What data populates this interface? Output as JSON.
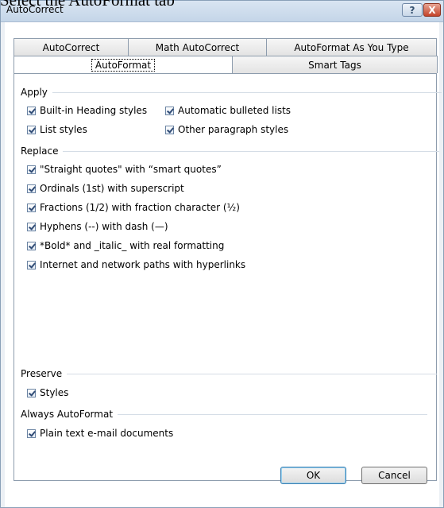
{
  "caption": "Select the AutoFormat tab",
  "window": {
    "title": "AutoCorrect",
    "help_label": "?",
    "close_label": "X"
  },
  "tabs": {
    "back_row": [
      "AutoCorrect",
      "Math AutoCorrect",
      "AutoFormat As You Type"
    ],
    "front_row": [
      "AutoFormat",
      "Smart Tags"
    ],
    "active": "AutoFormat"
  },
  "groups": {
    "apply": {
      "label": "Apply",
      "options": [
        {
          "label": "Built-in Heading styles",
          "checked": true
        },
        {
          "label": "Automatic bulleted lists",
          "checked": true
        },
        {
          "label": "List styles",
          "checked": true
        },
        {
          "label": "Other paragraph styles",
          "checked": true
        }
      ]
    },
    "replace": {
      "label": "Replace",
      "options": [
        {
          "label": "\"Straight quotes\" with “smart quotes”",
          "checked": true
        },
        {
          "label": "Ordinals (1st) with superscript",
          "checked": true
        },
        {
          "label": "Fractions (1/2) with fraction character (½)",
          "checked": true
        },
        {
          "label": "Hyphens (--) with dash (—)",
          "checked": true
        },
        {
          "label": "*Bold* and _italic_ with real formatting",
          "checked": true
        },
        {
          "label": "Internet and network paths with hyperlinks",
          "checked": true
        }
      ]
    },
    "preserve": {
      "label": "Preserve",
      "options": [
        {
          "label": "Styles",
          "checked": true
        }
      ]
    },
    "always": {
      "label": "Always AutoFormat",
      "options": [
        {
          "label": "Plain text e-mail documents",
          "checked": true
        }
      ]
    }
  },
  "buttons": {
    "ok": "OK",
    "cancel": "Cancel"
  }
}
